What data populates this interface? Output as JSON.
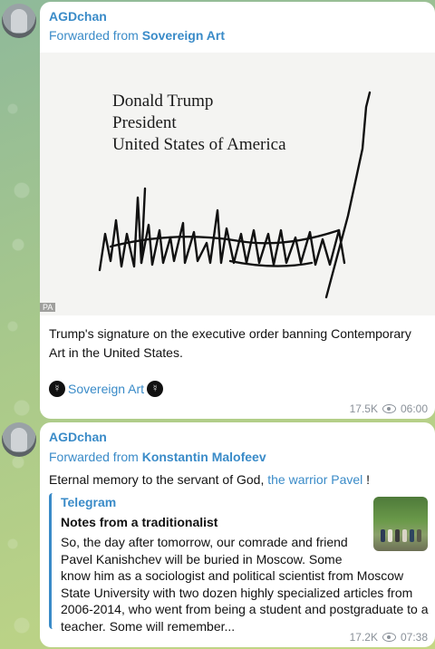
{
  "messages": [
    {
      "sender": "AGDchan",
      "forwarded_prefix": "Forwarded from ",
      "forwarded_from": "Sovereign Art",
      "photo": {
        "printed_lines": [
          "Donald Trump",
          "President",
          "United States of America"
        ],
        "credit": "PA"
      },
      "caption": "Trump's signature on the executive order banning Contemporary Art in the United States.",
      "signature_link": "Sovereign Art",
      "views": "17.5K",
      "time": "06:00"
    },
    {
      "sender": "AGDchan",
      "forwarded_prefix": "Forwarded from ",
      "forwarded_from": "Konstantin Malofeev",
      "text_prefix": "Eternal memory to the servant of God, ",
      "text_link": "the warrior Pavel",
      "text_suffix": " !",
      "link_preview": {
        "site": "Telegram",
        "title": "Notes from a traditionalist",
        "description_lines": [
          "So, the day after tomorrow, our comrade and friend",
          "Pavel Kanishchev will be buried in Moscow. Some",
          "know him as a sociologist and political scientist from Moscow",
          "State University with two dozen highly specialized articles from",
          "2006-2014, who went from being a student and postgraduate to a",
          "teacher. Some will remember..."
        ]
      },
      "views": "17.2K",
      "time": "07:38"
    }
  ],
  "colors": {
    "accent": "#3a8bc8",
    "meta": "#8a9199",
    "bubble": "#ffffff"
  },
  "icons": [
    "avatar",
    "eye-icon",
    "emblem-icon"
  ]
}
